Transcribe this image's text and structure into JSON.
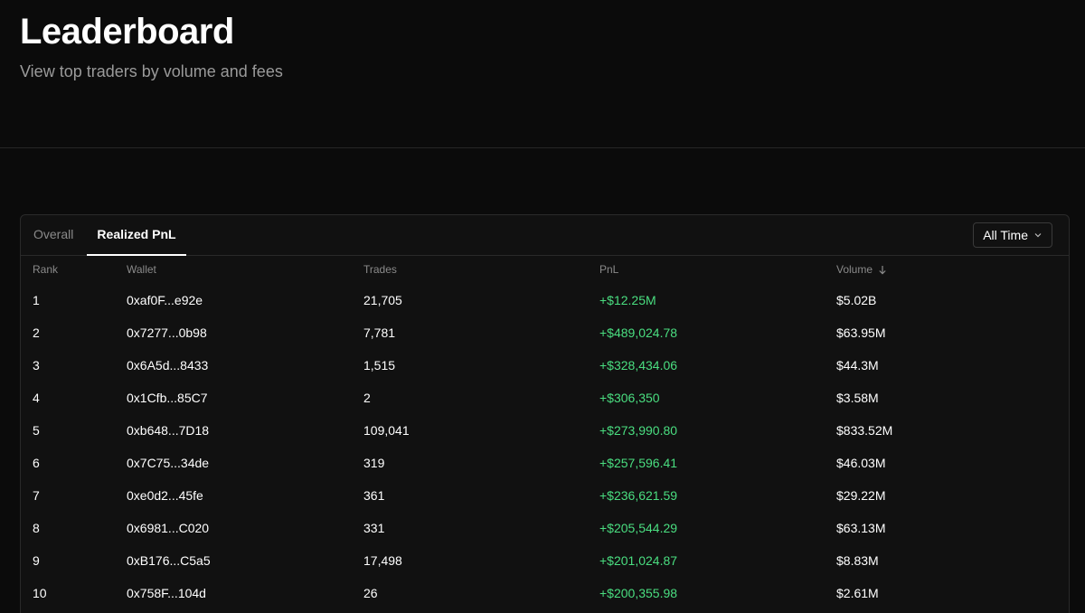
{
  "header": {
    "title": "Leaderboard",
    "subtitle": "View top traders by volume and fees"
  },
  "tabs": [
    {
      "label": "Overall",
      "active": false
    },
    {
      "label": "Realized PnL",
      "active": true
    }
  ],
  "time_filter": {
    "selected": "All Time"
  },
  "columns": {
    "rank": "Rank",
    "wallet": "Wallet",
    "trades": "Trades",
    "pnl": "PnL",
    "volume": "Volume"
  },
  "sort": {
    "column": "volume",
    "direction": "descending"
  },
  "colors": {
    "background": "#0b0b0b",
    "card": "#111111",
    "positive": "#4ade80"
  },
  "rows": [
    {
      "rank": "1",
      "wallet": "0xaf0F...e92e",
      "trades": "21,705",
      "pnl": "+$12.25M",
      "volume": "$5.02B"
    },
    {
      "rank": "2",
      "wallet": "0x7277...0b98",
      "trades": "7,781",
      "pnl": "+$489,024.78",
      "volume": "$63.95M"
    },
    {
      "rank": "3",
      "wallet": "0x6A5d...8433",
      "trades": "1,515",
      "pnl": "+$328,434.06",
      "volume": "$44.3M"
    },
    {
      "rank": "4",
      "wallet": "0x1Cfb...85C7",
      "trades": "2",
      "pnl": "+$306,350",
      "volume": "$3.58M"
    },
    {
      "rank": "5",
      "wallet": "0xb648...7D18",
      "trades": "109,041",
      "pnl": "+$273,990.80",
      "volume": "$833.52M"
    },
    {
      "rank": "6",
      "wallet": "0x7C75...34de",
      "trades": "319",
      "pnl": "+$257,596.41",
      "volume": "$46.03M"
    },
    {
      "rank": "7",
      "wallet": "0xe0d2...45fe",
      "trades": "361",
      "pnl": "+$236,621.59",
      "volume": "$29.22M"
    },
    {
      "rank": "8",
      "wallet": "0x6981...C020",
      "trades": "331",
      "pnl": "+$205,544.29",
      "volume": "$63.13M"
    },
    {
      "rank": "9",
      "wallet": "0xB176...C5a5",
      "trades": "17,498",
      "pnl": "+$201,024.87",
      "volume": "$8.83M"
    },
    {
      "rank": "10",
      "wallet": "0x758F...104d",
      "trades": "26",
      "pnl": "+$200,355.98",
      "volume": "$2.61M"
    }
  ]
}
